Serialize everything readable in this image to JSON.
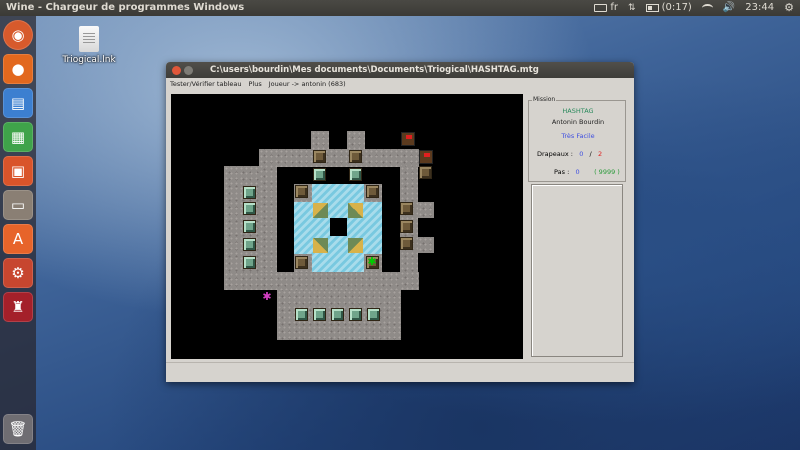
{
  "topbar": {
    "title": "Wine - Chargeur de programmes Windows",
    "keyboard_layout": "fr",
    "battery": "(0:17)",
    "clock": "23:44"
  },
  "desktop": {
    "icon_label": "Triogical.lnk"
  },
  "window": {
    "title": "C:\\users\\bourdin\\Mes documents\\Documents\\Triogical\\HASHTAG.mtg",
    "menu": [
      "Tester/Vérifier tableau",
      "Plus",
      "Joueur -> antonin (683)"
    ]
  },
  "mission": {
    "legend": "Mission",
    "name": "HASHTAG",
    "author": "Antonin Bourdin",
    "difficulty": "Très Facile",
    "flags_label": "Drapeaux :",
    "flags_current": "0",
    "flags_sep": "/",
    "flags_total": "2",
    "steps_label": "Pas :",
    "steps_current": "0",
    "steps_best": "( 9999 )"
  },
  "colors": {
    "mission_name": "#2a8a5c",
    "difficulty": "#3f4fe0",
    "flags_current": "#3f4fe0",
    "flags_total": "#e02020",
    "steps_best": "#2a9a3a"
  }
}
